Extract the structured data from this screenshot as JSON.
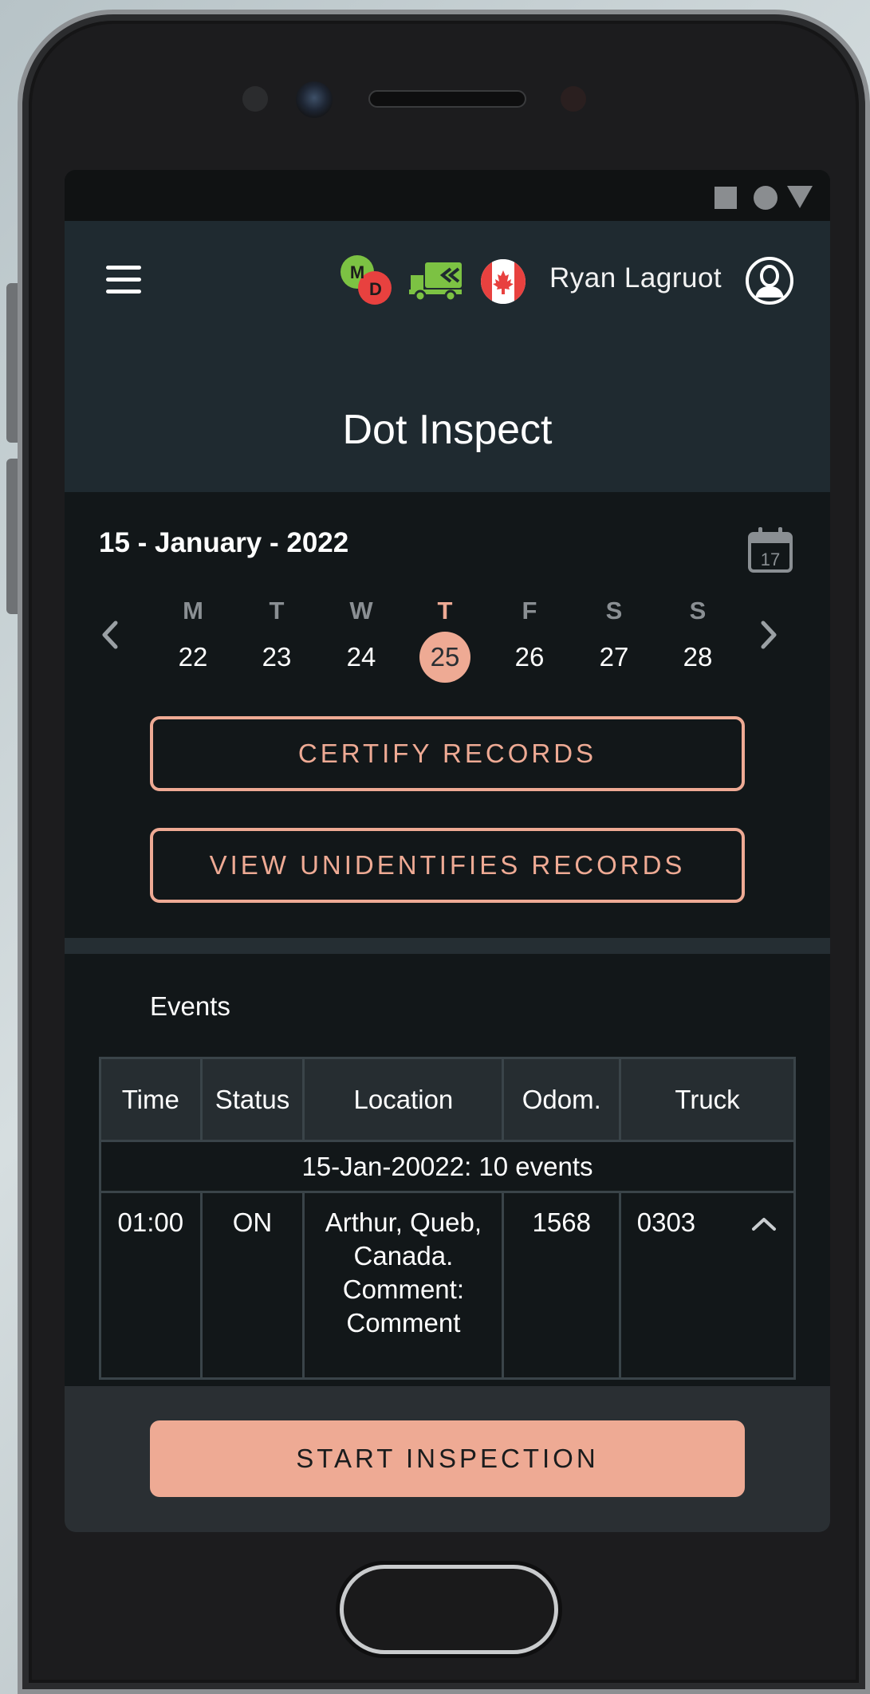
{
  "header": {
    "user_name": "Ryan Lagruot",
    "title": "Dot Inspect",
    "md_badge": {
      "top": "M",
      "bottom": "D"
    }
  },
  "calendar": {
    "date_label": "15 - January - 2022",
    "icon_day": "17",
    "days": [
      {
        "letter": "M",
        "num": "22"
      },
      {
        "letter": "T",
        "num": "23"
      },
      {
        "letter": "W",
        "num": "24"
      },
      {
        "letter": "T",
        "num": "25",
        "active": true
      },
      {
        "letter": "F",
        "num": "26"
      },
      {
        "letter": "S",
        "num": "27"
      },
      {
        "letter": "S",
        "num": "28"
      }
    ]
  },
  "actions": {
    "certify": "CERTIFY RECORDS",
    "view_unidentified": "VIEW UNIDENTIFIES RECORDS",
    "start_inspection": "START INSPECTION"
  },
  "events": {
    "label": "Events",
    "columns": [
      "Time",
      "Status",
      "Location",
      "Odom.",
      "Truck"
    ],
    "group_label": "15-Jan-20022: 10 events",
    "rows": [
      {
        "time": "01:00",
        "status": "ON",
        "location_lines": [
          "Arthur, Queb,",
          "Canada.",
          "Comment:",
          "Comment"
        ],
        "odom": "1568",
        "truck": "0303"
      }
    ]
  },
  "colors": {
    "accent": "#eeaa94",
    "appbar": "#1f2a30",
    "screen_bg": "#121719",
    "bottom_bar": "#2a2f33"
  },
  "icons": [
    "menu-icon",
    "md-badge-icon",
    "truck-icon",
    "canada-flag-icon",
    "user-avatar-icon",
    "calendar-icon",
    "chevron-left-icon",
    "chevron-right-icon",
    "chevron-up-icon"
  ]
}
